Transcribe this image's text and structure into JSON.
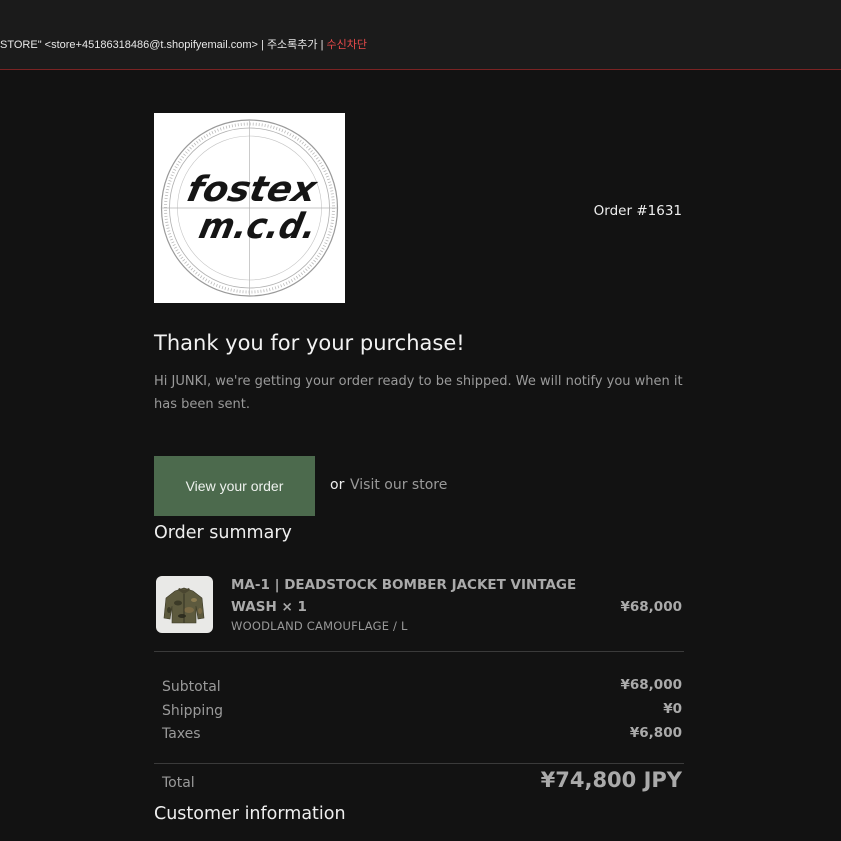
{
  "header": {
    "sender_name": "STORE\"",
    "sender_email": "<store+45186318486@t.shopifyemail.com>",
    "separator": "|",
    "add_contact": "주소록추가",
    "block_sender": "수신차단"
  },
  "logo": {
    "line1": "fostex",
    "line2": "m.c.d."
  },
  "order": {
    "number": "Order #1631"
  },
  "greeting": {
    "title": "Thank you for your purchase!",
    "body": "Hi JUNKI, we're getting your order ready to be shipped. We will notify you when it has been sent."
  },
  "actions": {
    "view_order": "View your order",
    "or": "or",
    "visit_store": "Visit our store"
  },
  "summary": {
    "title": "Order summary",
    "items": [
      {
        "name": "MA-1 | DEADSTOCK BOMBER JACKET VINTAGE WASH × 1",
        "variant": "WOODLAND CAMOUFLAGE / L",
        "price": "¥68,000"
      }
    ],
    "subtotal_label": "Subtotal",
    "subtotal_value": "¥68,000",
    "shipping_label": "Shipping",
    "shipping_value": "¥0",
    "taxes_label": "Taxes",
    "taxes_value": "¥6,800",
    "total_label": "Total",
    "total_value": "¥74,800 JPY"
  },
  "customer": {
    "title": "Customer information"
  },
  "colors": {
    "background": "#121212",
    "button": "#4c6a4d",
    "accent_red": "#e94a4a"
  }
}
